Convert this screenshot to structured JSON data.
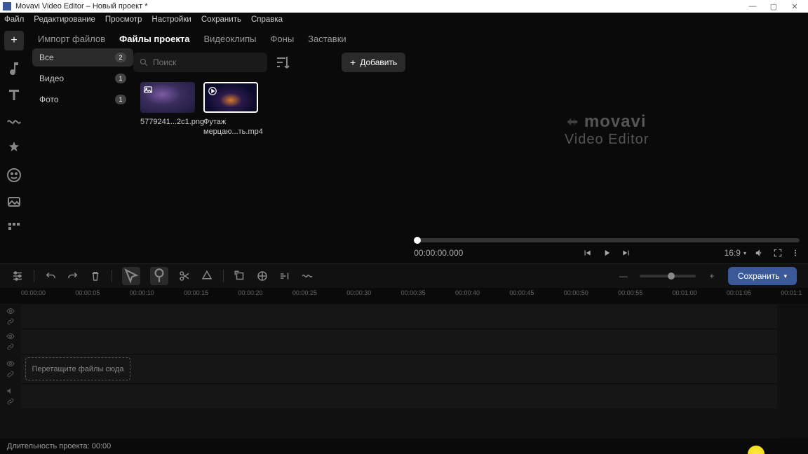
{
  "window": {
    "title": "Movavi Video Editor – Новый проект *"
  },
  "menu": [
    "Файл",
    "Редактирование",
    "Просмотр",
    "Настройки",
    "Сохранить",
    "Справка"
  ],
  "tabs": [
    "Импорт файлов",
    "Файлы проекта",
    "Видеоклипы",
    "Фоны",
    "Заставки"
  ],
  "active_tab": 1,
  "categories": [
    {
      "label": "Все",
      "count": "2",
      "active": true
    },
    {
      "label": "Видео",
      "count": "1",
      "active": false
    },
    {
      "label": "Фото",
      "count": "1",
      "active": false
    }
  ],
  "search": {
    "placeholder": "Поиск"
  },
  "add_button": "Добавить",
  "files": [
    {
      "name": "5779241...2c1.png",
      "kind": "image"
    },
    {
      "name": "Футаж мерцаю...ть.mp4",
      "kind": "video"
    }
  ],
  "logo": {
    "brand": "movavi",
    "product": "Video Editor"
  },
  "player": {
    "time": "00:00:00.000",
    "aspect": "16:9"
  },
  "ruler_ticks": [
    "00:00:00",
    "00:00:05",
    "00:00:10",
    "00:00:15",
    "00:00:20",
    "00:00:25",
    "00:00:30",
    "00:00:35",
    "00:00:40",
    "00:00:45",
    "00:00:50",
    "00:00:55",
    "00:01:00",
    "00:01:05",
    "00:01:1"
  ],
  "timeline": {
    "drop_hint": "Перетащите файлы сюда",
    "export_label": "Сохранить"
  },
  "status": {
    "duration_label": "Длительность проекта: 00:00"
  }
}
